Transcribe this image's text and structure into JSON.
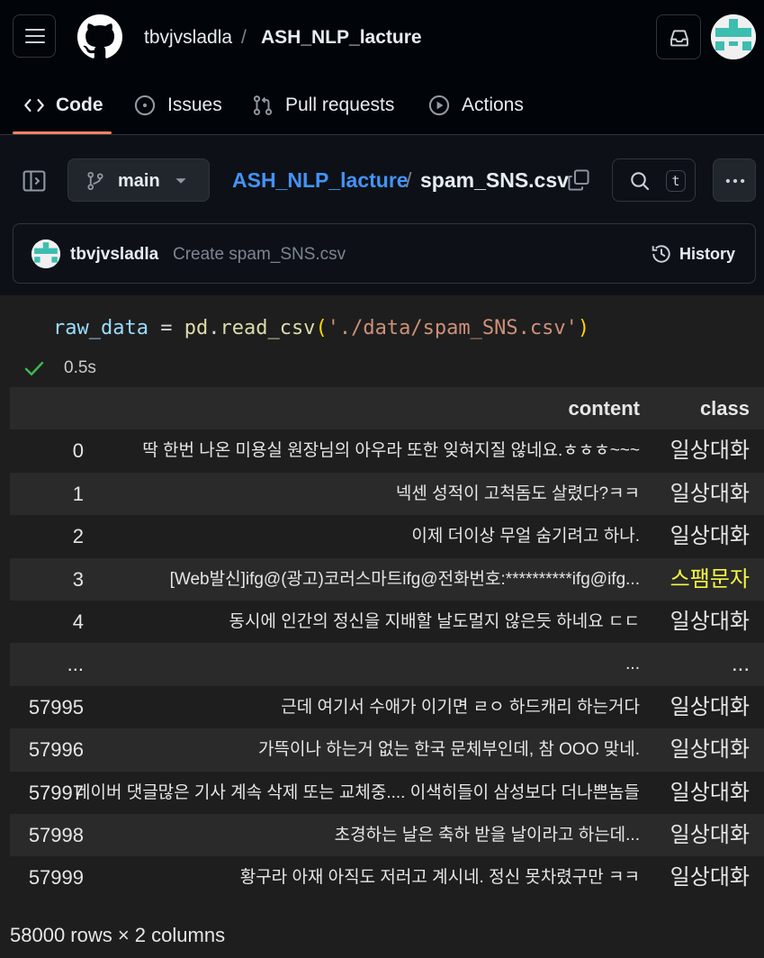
{
  "header": {
    "owner": "tbvjvsladla",
    "slash": "/",
    "repo": "ASH_NLP_lacture"
  },
  "nav": {
    "tabs": [
      {
        "label": "Code",
        "icon": "code-icon",
        "active": true
      },
      {
        "label": "Issues",
        "icon": "issue-icon"
      },
      {
        "label": "Pull requests",
        "icon": "pull-request-icon"
      },
      {
        "label": "Actions",
        "icon": "play-icon"
      }
    ]
  },
  "filebar": {
    "branch": "main",
    "path_repo": "ASH_NLP_lacture",
    "path_sep": "/",
    "path_file": "spam_SNS.csv",
    "search_shortcut": "t"
  },
  "commit": {
    "user": "tbvjvsladla",
    "message": "Create spam_SNS.csv",
    "history_label": "History"
  },
  "notebook": {
    "code": {
      "var": "raw_data",
      "op": " = ",
      "mod": "pd",
      "dot": ".",
      "fn": "read_csv",
      "open": "(",
      "str": "'./data/spam_SNS.csv'",
      "close": ")"
    },
    "exec_time": "0.5s",
    "table": {
      "columns": [
        "content",
        "class"
      ],
      "rows": [
        {
          "idx": "0",
          "content": "딱 한번 나온 미용실 원장님의 아우라 또한 잊혀지질 않네요.ㅎㅎㅎ~~~",
          "class": "일상대화"
        },
        {
          "idx": "1",
          "content": "넥센 성적이 고척돔도 살렸다?ㅋㅋ",
          "class": "일상대화"
        },
        {
          "idx": "2",
          "content": "이제 더이상 무얼 숨기려고 하나.",
          "class": "일상대화"
        },
        {
          "idx": "3",
          "content": "[Web발신]ifg@(광고)코러스마트ifg@전화번호:**********ifg@ifg...",
          "class": "스팸문자"
        },
        {
          "idx": "4",
          "content": "동시에 인간의 정신을 지배할 날도멀지 않은듯 하네요 ㄷㄷ",
          "class": "일상대화"
        },
        {
          "idx": "...",
          "content": "...",
          "class": "..."
        },
        {
          "idx": "57995",
          "content": "근데 여기서 수애가 이기면 ㄹㅇ 하드캐리 하는거다",
          "class": "일상대화"
        },
        {
          "idx": "57996",
          "content": "가뜩이나 하는거 없는 한국 문체부인데, 참 OOO 맞네.",
          "class": "일상대화"
        },
        {
          "idx": "57997",
          "content": "네이버 댓글많은 기사 계속 삭제 또는 교체중.... 이색히들이 삼성보다 더나쁜놈들",
          "class": "일상대화"
        },
        {
          "idx": "57998",
          "content": "초경하는 날은 축하 받을 날이라고 하는데...",
          "class": "일상대화"
        },
        {
          "idx": "57999",
          "content": "황구라 아재 아직도 저러고 계시네. 정신 못차렸구만 ㅋㅋ",
          "class": "일상대화"
        }
      ],
      "shape": "58000 rows × 2 columns"
    }
  },
  "colors": {
    "link": "#4493f8",
    "active_tab": "#f78166",
    "spam": "#f5f543",
    "success": "#3fb950"
  }
}
